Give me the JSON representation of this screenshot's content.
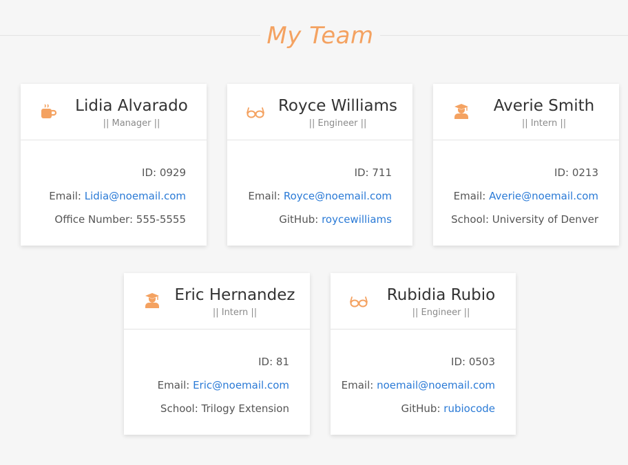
{
  "header": {
    "title": "My Team"
  },
  "colors": {
    "accent": "#f4a261",
    "link": "#2a7ad6",
    "background": "#f6f6f6"
  },
  "cards": [
    {
      "name": "Lidia Alvarado",
      "role": "|| Manager ||",
      "icon": "coffee-icon",
      "lines": [
        {
          "label": "ID: ",
          "value": "0929",
          "link": false
        },
        {
          "label": "Email: ",
          "value": "Lidia@noemail.com",
          "link": true
        },
        {
          "label": "Office Number: ",
          "value": "555-5555",
          "link": false
        }
      ]
    },
    {
      "name": "Royce Williams",
      "role": "|| Engineer ||",
      "icon": "glasses-icon",
      "lines": [
        {
          "label": "ID: ",
          "value": "711",
          "link": false
        },
        {
          "label": "Email: ",
          "value": "Royce@noemail.com",
          "link": true
        },
        {
          "label": "GitHub: ",
          "value": "roycewilliams",
          "link": true
        }
      ]
    },
    {
      "name": "Averie Smith",
      "role": "|| Intern ||",
      "icon": "graduate-icon",
      "lines": [
        {
          "label": "ID: ",
          "value": "0213",
          "link": false
        },
        {
          "label": "Email: ",
          "value": "Averie@noemail.com",
          "link": true
        },
        {
          "label": "School: ",
          "value": "University of Denver",
          "link": false
        }
      ]
    },
    {
      "name": "Eric Hernandez",
      "role": "|| Intern ||",
      "icon": "graduate-icon",
      "lines": [
        {
          "label": "ID: ",
          "value": "81",
          "link": false
        },
        {
          "label": "Email: ",
          "value": "Eric@noemail.com",
          "link": true
        },
        {
          "label": "School: ",
          "value": "Trilogy Extension",
          "link": false
        }
      ]
    },
    {
      "name": "Rubidia Rubio",
      "role": "|| Engineer ||",
      "icon": "glasses-icon",
      "lines": [
        {
          "label": "ID: ",
          "value": "0503",
          "link": false
        },
        {
          "label": "Email: ",
          "value": "noemail@noemail.com",
          "link": true
        },
        {
          "label": "GitHub: ",
          "value": "rubiocode",
          "link": true
        }
      ]
    }
  ]
}
